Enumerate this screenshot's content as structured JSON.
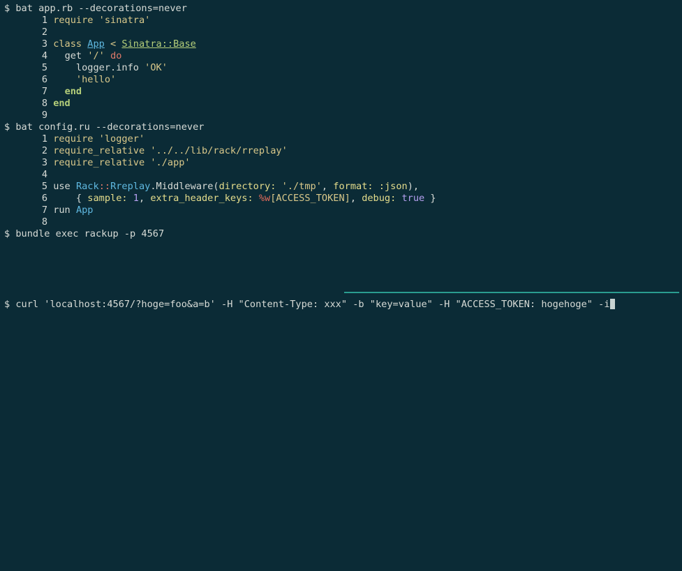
{
  "terminal": {
    "prompt": "$",
    "commands": {
      "bat_app": "bat app.rb --decorations=never",
      "bat_config": "bat config.ru --decorations=never",
      "bundle": "bundle exec rackup -p 4567",
      "curl": "curl 'localhost:4567/?hoge=foo&a=b' -H \"Content-Type: xxx\" -b \"key=value\" -H \"ACCESS_TOKEN: hogehoge\" -i"
    },
    "app_rb": [
      {
        "n": "1"
      },
      {
        "n": "2"
      },
      {
        "n": "3"
      },
      {
        "n": "4"
      },
      {
        "n": "5"
      },
      {
        "n": "6"
      },
      {
        "n": "7"
      },
      {
        "n": "8"
      },
      {
        "n": "9"
      }
    ],
    "config_ru": [
      {
        "n": "1"
      },
      {
        "n": "2"
      },
      {
        "n": "3"
      },
      {
        "n": "4"
      },
      {
        "n": "5"
      },
      {
        "n": "6"
      },
      {
        "n": "7"
      },
      {
        "n": "8"
      }
    ],
    "tokens": {
      "require": "require",
      "sinatra": "'sinatra'",
      "class": "class",
      "App": "App",
      "lt": "<",
      "base": "Sinatra::Base",
      "get": "get",
      "root": "'/'",
      "do": "do",
      "logger_info": "logger.info",
      "ok": "'OK'",
      "hello": "'hello'",
      "end": "end",
      "logger": "'logger'",
      "require_relative": "require_relative",
      "rreplay_path": "'../../lib/rack/rreplay'",
      "app_path": "'./app'",
      "use": "use",
      "rack": "Rack",
      "colons": "::",
      "rreplay": "Rreplay",
      "middleware": ".Middleware(",
      "directory": "directory:",
      "tmp": "'./tmp'",
      "comma": ",",
      "format": "format:",
      "json": ":json",
      "close_paren": "),",
      "brace_open": "{",
      "sample": "sample:",
      "one": "1",
      "extra_header_keys": "extra_header_keys:",
      "pw": "%w",
      "access_token": "[ACCESS_TOKEN]",
      "debug": "debug:",
      "true": "true",
      "brace_close": "}",
      "run": "run"
    }
  }
}
